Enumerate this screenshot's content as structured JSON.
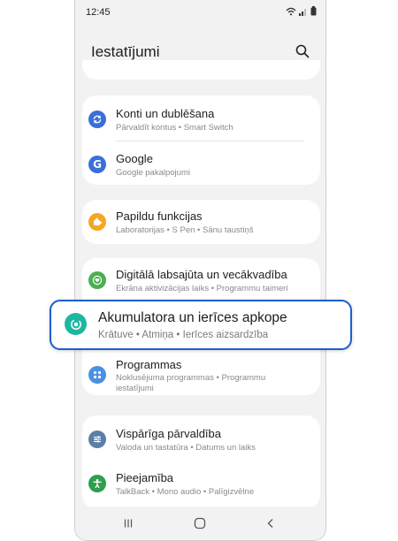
{
  "status": {
    "time": "12:45"
  },
  "header": {
    "title": "Iestatījumi"
  },
  "items": {
    "accounts": {
      "title": "Konti un dublēšana",
      "sub": "Pārvaldīt kontus • Smart Switch"
    },
    "google": {
      "title": "Google",
      "sub": "Google pakalpojumi"
    },
    "advanced": {
      "title": "Papildu funkcijas",
      "sub": "Laboratorijas • S Pen • Sānu taustiņš"
    },
    "wellbeing": {
      "title": "Digitālā labsajūta un vecākvadība",
      "sub": "Ekrāna aktivizācijas laiks • Programmu taimeri"
    },
    "apps": {
      "title": "Programmas",
      "sub1": "Noklusējuma programmas • Programmu",
      "sub2": "iestatījumi"
    },
    "general": {
      "title": "Vispārīga pārvaldība",
      "sub": "Valoda un tastatūra • Datums un laiks"
    },
    "accessibility": {
      "title": "Pieejamība",
      "sub": "TalkBack • Mono audio • Palīgizvēlne"
    }
  },
  "highlight": {
    "title": "Akumulatora un ierīces apkope",
    "sub": "Krātuve  •  Atmiņa  •  Ierīces aizsardzība"
  },
  "colors": {
    "accounts": "#3b6fd8",
    "google": "#3b6fd8",
    "advanced": "#f5a623",
    "wellbeing": "#4caf50",
    "battery": "#1db7a0",
    "apps": "#4a90e2",
    "general": "#5b7fa6",
    "accessibility": "#2e9e4f",
    "highlight_border": "#1a5fcf"
  }
}
